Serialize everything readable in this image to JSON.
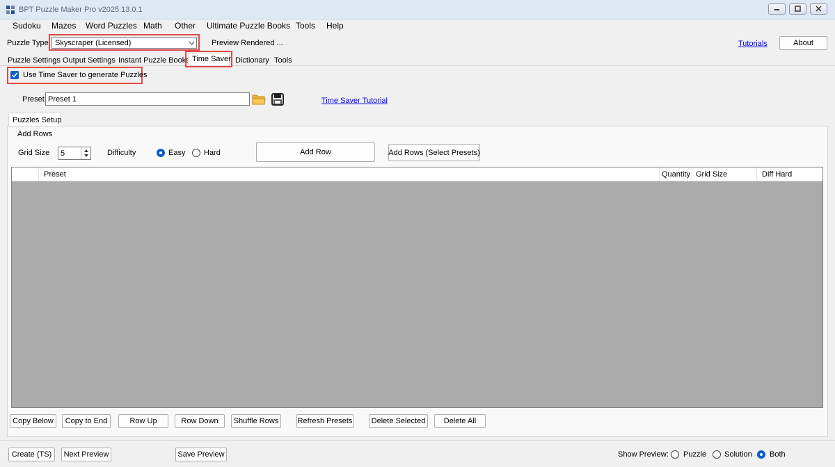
{
  "window": {
    "title": "BPT Puzzle Maker Pro v2025.13.0.1"
  },
  "menu": [
    "Sudoku",
    "Mazes",
    "Word Puzzles",
    "Math",
    "Other",
    "Ultimate Puzzle Books",
    "Tools",
    "Help"
  ],
  "toolbar": {
    "puzzle_type_label": "Puzzle Type",
    "puzzle_type_value": "Skyscraper (Licensed)",
    "preview_status": "Preview Rendered ...",
    "tutorials_link": "Tutorials",
    "about_button": "About"
  },
  "tabs": [
    "Puzzle Settings",
    "Output Settings",
    "Instant Puzzle Books",
    "Time Saver",
    "Dictionary",
    "Tools"
  ],
  "time_saver": {
    "use_checkbox_label": "Use Time Saver to generate Puzzles",
    "use_checkbox_checked": true,
    "preset_label": "Preset",
    "preset_value": "Preset 1",
    "tutorial_link": "Time Saver Tutorial"
  },
  "puzzles_setup": {
    "tab_label": "Puzzles Setup",
    "group_label": "Add Rows",
    "grid_size_label": "Grid Size",
    "grid_size_value": "5",
    "difficulty_label": "Difficulty",
    "easy_label": "Easy",
    "hard_label": "Hard",
    "difficulty_selected": "Easy",
    "add_row_button": "Add Row",
    "add_rows_presets_button": "Add Rows (Select Presets)"
  },
  "table": {
    "columns": [
      "Preset",
      "Quantity",
      "Grid Size",
      "Diff Hard"
    ],
    "rows": []
  },
  "row_buttons": [
    "Copy Below",
    "Copy to End",
    "Row Up",
    "Row Down",
    "Shuffle Rows",
    "Refresh Presets",
    "Delete Selected",
    "Delete All"
  ],
  "bottom": {
    "create_button": "Create (TS)",
    "next_preview_button": "Next Preview",
    "save_preview_button": "Save Preview",
    "show_preview_label": "Show Preview:",
    "options": [
      "Puzzle",
      "Solution",
      "Both"
    ],
    "selected": "Both"
  },
  "colors": {
    "accent": "#0a5fc9",
    "highlight": "#e04848",
    "grid_bg": "#ababab"
  }
}
